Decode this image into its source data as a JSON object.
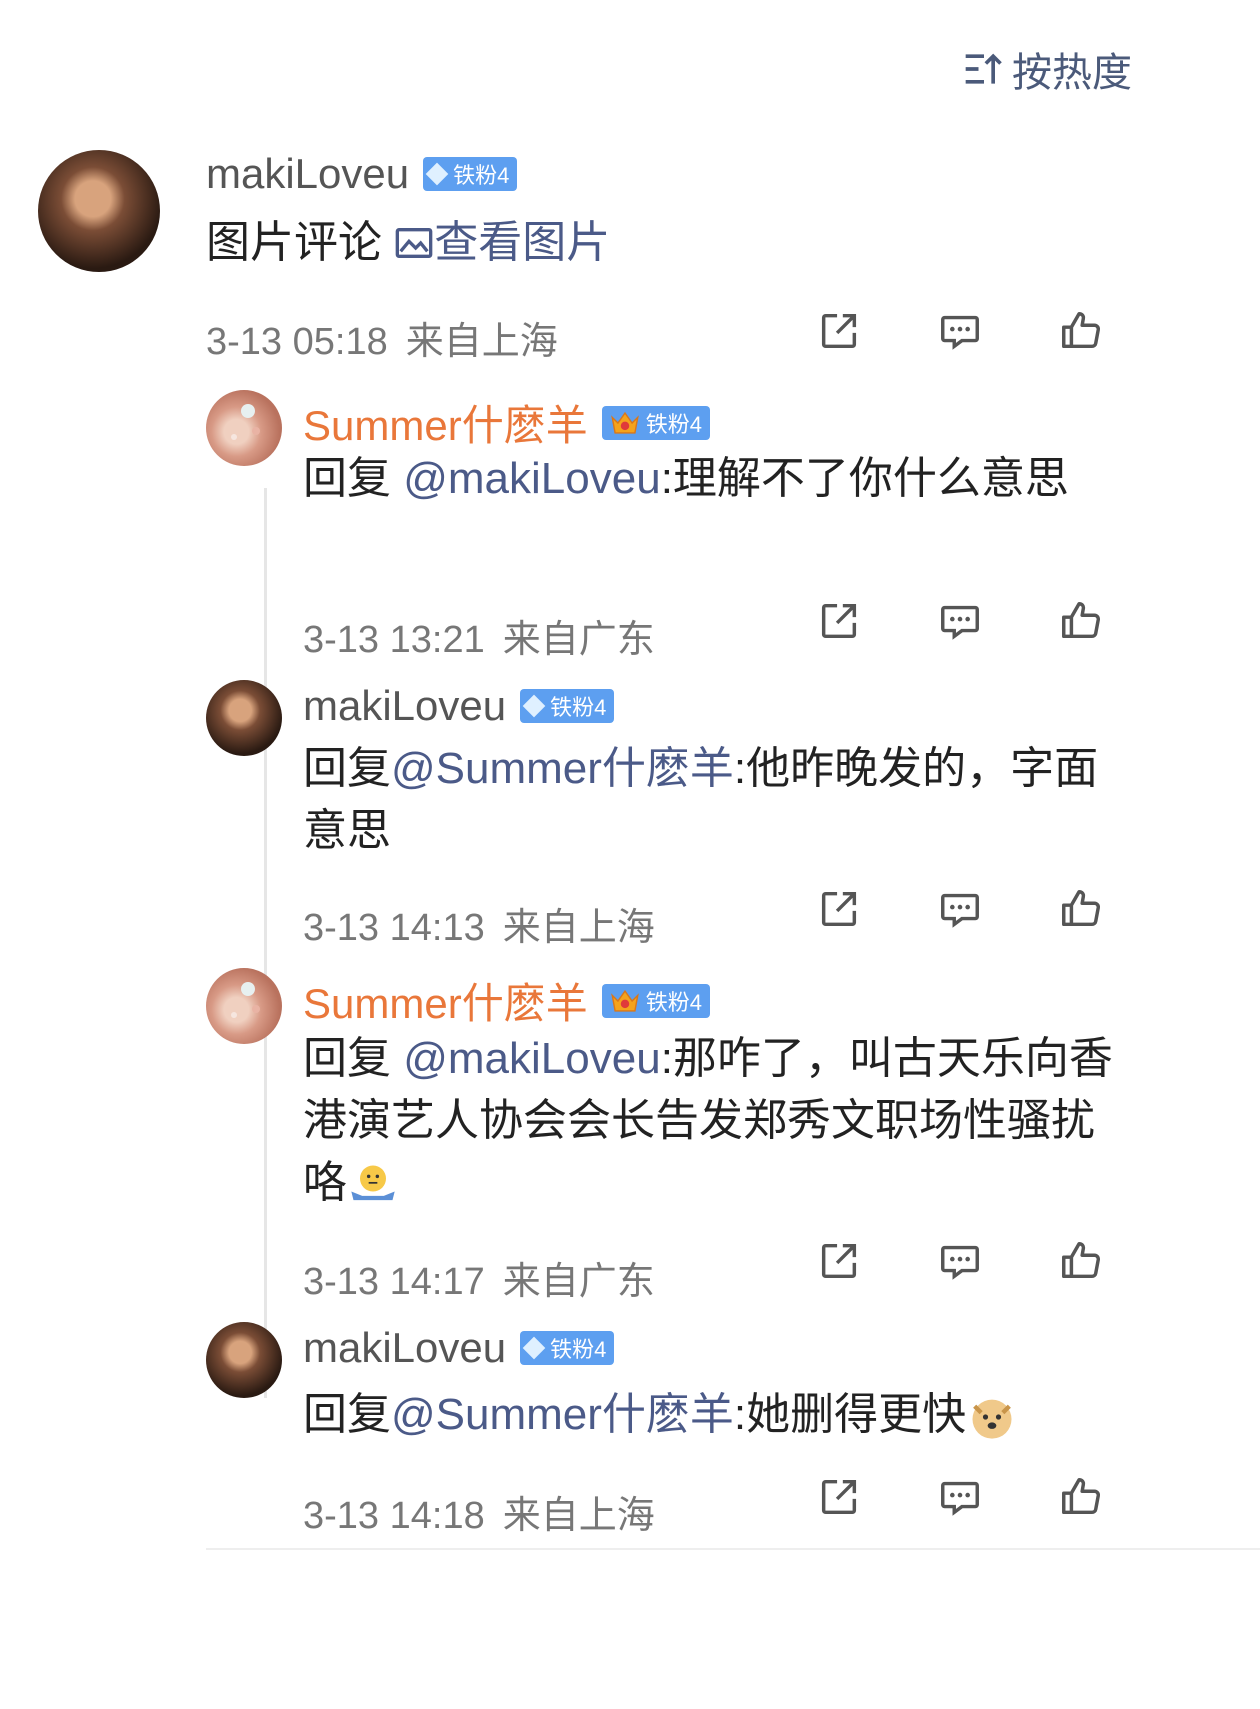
{
  "sort_label": "按热度",
  "comments": [
    {
      "username": "makiLoveu",
      "badge": "铁粉4",
      "text": "图片评论 ",
      "link": "查看图片",
      "time": "3-13 05:18",
      "location": "来自上海"
    },
    {
      "username": "Summer什麽羊",
      "badge": "铁粉4",
      "prefix": "回复 ",
      "mention": "@makiLoveu",
      "body": ":理解不了你什么意思",
      "time": "3-13 13:21",
      "location": "来自广东"
    },
    {
      "username": "makiLoveu",
      "badge": "铁粉4",
      "prefix": "回复",
      "mention": "@Summer什麽羊",
      "body": ":他昨晚发的，字面意思",
      "time": "3-13 14:13",
      "location": "来自上海"
    },
    {
      "username": "Summer什麽羊",
      "badge": "铁粉4",
      "prefix": "回复 ",
      "mention": "@makiLoveu",
      "body": ":那咋了，叫古天乐向香港演艺人协会会长告发郑秀文职场性骚扰咯",
      "time": "3-13 14:17",
      "location": "来自广东"
    },
    {
      "username": "makiLoveu",
      "badge": "铁粉4",
      "prefix": "回复",
      "mention": "@Summer什麽羊",
      "body": ":她删得更快",
      "time": "3-13 14:18",
      "location": "来自上海"
    }
  ],
  "colors": {
    "accent_orange": "#e9773a",
    "link_blue": "#4b5a88",
    "badge_blue": "#5d9ff0"
  }
}
